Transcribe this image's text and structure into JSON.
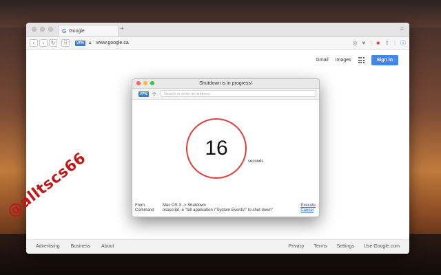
{
  "browser": {
    "tab_title": "Google",
    "favicon": "G",
    "url": "www.google.ca",
    "vpn_badge": "VPN"
  },
  "google": {
    "links": [
      "Gmail",
      "Images"
    ],
    "sign_in": "Sign in",
    "footer_left": [
      "Advertising",
      "Business",
      "About"
    ],
    "footer_right": [
      "Privacy",
      "Terms",
      "Settings",
      "Use Google.com"
    ]
  },
  "dialog": {
    "title": "Shutdown is in progress!",
    "vpn_badge": "VPN",
    "search_placeholder": "Search or enter an address",
    "countdown": "16",
    "unit": "seconds",
    "from_label": "From",
    "from_value": "Mac OS X -> Shutdown",
    "command_label": "Command",
    "command_value": "osascript -e \"tell application \\\"System Events\\\" to shut down\"",
    "execute": "Execute",
    "cancel": "Cancel",
    "ring_color": "#e23b3b"
  },
  "watermark": "@alltscs66"
}
